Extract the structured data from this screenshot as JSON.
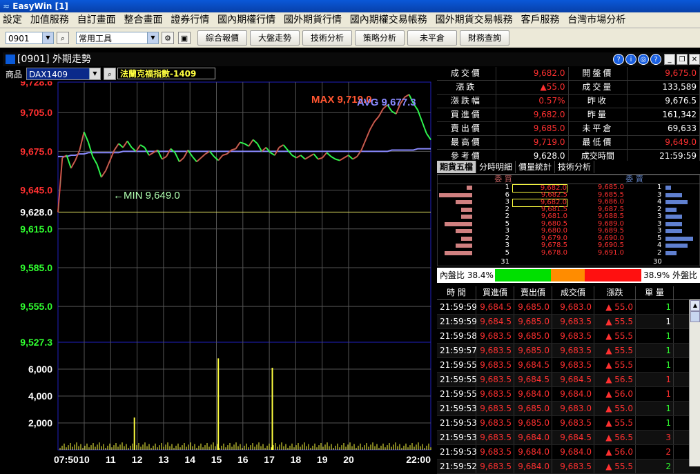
{
  "app": {
    "title": "EasyWin  [1]"
  },
  "menu": [
    "設定",
    "加值服務",
    "自訂畫面",
    "整合畫面",
    "證券行情",
    "國內期權行情",
    "國外期貨行情",
    "國內期權交易帳務",
    "國外期貨交易帳務",
    "客戶服務",
    "台灣市場分析"
  ],
  "toolbar": {
    "code_value": "0901",
    "tools_value": "常用工具",
    "buttons": [
      "綜合報價",
      "大盤走勢",
      "技術分析",
      "策略分析",
      "未平倉",
      "財務查詢"
    ]
  },
  "window": {
    "title": "[0901] 外期走勢",
    "controls": [
      "?",
      "i",
      "?"
    ]
  },
  "product": {
    "label": "商品",
    "code_value": "DAX1409",
    "name": "法蘭克福指數-1409"
  },
  "chart_data": {
    "type": "line",
    "x_ticks": [
      "07:50",
      "10",
      "11",
      "12",
      "13",
      "14",
      "15",
      "16",
      "17",
      "18",
      "19",
      "20",
      "22:00"
    ],
    "price_axis": {
      "ticks": [
        "9,728.6",
        "9,705.0",
        "9,675.0",
        "9,645.0",
        "9,628.0",
        "9,615.0",
        "9,585.0",
        "9,555.0",
        "9,527.3"
      ],
      "ylim": [
        9527.3,
        9728.6
      ],
      "reference": 9628.0
    },
    "volume_axis": {
      "ticks": [
        "6,000",
        "4,000",
        "2,000"
      ]
    },
    "annotations": {
      "max": "MAX 9,719.0",
      "avg": "AVG 9,677.3",
      "min": "←MIN 9,649.0"
    },
    "price_series": [
      9628.0,
      9670,
      9672,
      9662,
      9668,
      9676,
      9690,
      9682,
      9671,
      9665,
      9655,
      9660,
      9668,
      9676,
      9681,
      9678,
      9683,
      9678,
      9675,
      9680,
      9678,
      9672,
      9674,
      9676,
      9669,
      9671,
      9677,
      9674,
      9667,
      9670,
      9676,
      9671,
      9667,
      9670,
      9673,
      9675,
      9671,
      9668,
      9672,
      9673,
      9676,
      9677,
      9682,
      9681,
      9679,
      9684,
      9681,
      9675,
      9678,
      9674,
      9672,
      9678,
      9680,
      9676,
      9672,
      9670,
      9672,
      9669,
      9671,
      9673,
      9669,
      9670,
      9674,
      9671,
      9669,
      9668,
      9670,
      9672,
      9669,
      9671,
      9676,
      9684,
      9692,
      9698,
      9702,
      9708,
      9711,
      9706,
      9704,
      9712,
      9717,
      9719,
      9712,
      9707,
      9698,
      9689,
      9684
    ],
    "avg_series": [
      9671,
      9671,
      9671,
      9672,
      9672,
      9673,
      9673,
      9674,
      9674,
      9674,
      9674,
      9674,
      9674,
      9674,
      9674,
      9675,
      9675,
      9675,
      9675,
      9675,
      9675,
      9675,
      9675,
      9675,
      9675,
      9675,
      9675,
      9675,
      9675,
      9675,
      9675,
      9675,
      9675,
      9675,
      9675,
      9675,
      9675,
      9675,
      9675,
      9675,
      9675,
      9675,
      9675,
      9675,
      9675,
      9675,
      9675,
      9675,
      9675,
      9675,
      9675,
      9675,
      9675,
      9675,
      9675,
      9675,
      9675,
      9675,
      9675,
      9675,
      9675,
      9675,
      9675,
      9675,
      9675,
      9675,
      9675,
      9675,
      9675,
      9675,
      9675,
      9675,
      9675,
      9675,
      9675,
      9675,
      9675,
      9676,
      9676,
      9676,
      9676,
      9676,
      9676,
      9677,
      9677,
      9677,
      9677
    ],
    "volume_spikes": [
      {
        "x": 0.205,
        "v": 2400
      },
      {
        "x": 0.43,
        "v": 6800
      },
      {
        "x": 0.575,
        "v": 6100
      }
    ],
    "colors": {
      "price_up": "#ff3030",
      "price_down": "#30ff30",
      "price_line": "#2ad6a0",
      "avg": "#8a8aff",
      "ref": "#e0e060",
      "volume": "#ffff40",
      "grid": "#555555",
      "frame": "#2020c0"
    }
  },
  "quote": {
    "rows": [
      {
        "l1": "成交價",
        "v1": "9,682.0",
        "c1": "#ff3030",
        "l2": "開盤價",
        "v2": "9,675.0",
        "c2": "#ff3030"
      },
      {
        "l1": "漲跌",
        "v1": "▲55.0",
        "c1": "#ff3030",
        "l2": "成交量",
        "v2": "133,589",
        "c2": "#ffffff"
      },
      {
        "l1": "漲跌幅",
        "v1": "0.57%",
        "c1": "#ff3030",
        "l2": "昨收",
        "v2": "9,676.5",
        "c2": "#ffffff"
      },
      {
        "l1": "買進價",
        "v1": "9,682.0",
        "c1": "#ff3030",
        "l2": "昨量",
        "v2": "161,342",
        "c2": "#ffffff"
      },
      {
        "l1": "賣出價",
        "v1": "9,685.0",
        "c1": "#ff3030",
        "l2": "未平倉",
        "v2": "69,633",
        "c2": "#ffffff"
      },
      {
        "l1": "最高價",
        "v1": "9,719.0",
        "c1": "#ff3030",
        "l2": "最低價",
        "v2": "9,649.0",
        "c2": "#ff3030"
      },
      {
        "l1": "參考價",
        "v1": "9,628.0",
        "c1": "#ffffff",
        "l2": "成交時間",
        "v2": "21:59:59",
        "c2": "#ffffff"
      }
    ]
  },
  "tabs": [
    "期貨五檔",
    "分時明細",
    "價量統計",
    "技術分析"
  ],
  "orderbook": {
    "bid_header": "委 買",
    "ask_header": "委 賣",
    "rows": [
      {
        "bq": "1",
        "bp": "9,682.0",
        "ap": "9,685.0",
        "aq": "1"
      },
      {
        "bq": "6",
        "bp": "9,682.5",
        "ap": "9,685.5",
        "aq": "3"
      },
      {
        "bq": "3",
        "bp": "9,682.0",
        "ap": "9,686.0",
        "aq": "4"
      },
      {
        "bq": "2",
        "bp": "9,681.5",
        "ap": "9,687.5",
        "aq": "2"
      },
      {
        "bq": "2",
        "bp": "9,681.0",
        "ap": "9,688.5",
        "aq": "3"
      },
      {
        "bq": "5",
        "bp": "9,680.5",
        "ap": "9,689.0",
        "aq": "3"
      },
      {
        "bq": "3",
        "bp": "9,680.0",
        "ap": "9,689.5",
        "aq": "3"
      },
      {
        "bq": "2",
        "bp": "9,679.0",
        "ap": "9,690.0",
        "aq": "5"
      },
      {
        "bq": "3",
        "bp": "9,678.5",
        "ap": "9,690.5",
        "aq": "4"
      },
      {
        "bq": "5",
        "bp": "9,678.0",
        "ap": "9,691.0",
        "aq": "2"
      }
    ],
    "bid_total": "31",
    "ask_total": "30"
  },
  "ratio": {
    "left": "內盤比 38.4%",
    "right": "38.9% 外盤比",
    "bid_pct": 38.4,
    "mid_pct": 22.7,
    "ask_pct": 38.9
  },
  "ticks_table": {
    "headers": [
      "時 間",
      "買進價",
      "賣出價",
      "成交價",
      "漲跌",
      "單 量"
    ],
    "rows": [
      [
        "21:59:59",
        "9,684.5",
        "9,685.0",
        "9,683.0",
        "▲ 55.0",
        "1",
        "#30ff30"
      ],
      [
        "21:59:59",
        "9,684.5",
        "9,685.0",
        "9,683.5",
        "▲ 55.5",
        "1",
        "#ffffff"
      ],
      [
        "21:59:58",
        "9,683.5",
        "9,685.0",
        "9,683.5",
        "▲ 55.5",
        "1",
        "#30ff30"
      ],
      [
        "21:59:57",
        "9,683.5",
        "9,685.0",
        "9,683.5",
        "▲ 55.5",
        "1",
        "#30ff30"
      ],
      [
        "21:59:55",
        "9,683.5",
        "9,684.5",
        "9,683.5",
        "▲ 55.5",
        "1",
        "#30ff30"
      ],
      [
        "21:59:55",
        "9,683.5",
        "9,684.5",
        "9,684.5",
        "▲ 56.5",
        "1",
        "#ff3030"
      ],
      [
        "21:59:55",
        "9,683.5",
        "9,684.0",
        "9,684.0",
        "▲ 56.0",
        "1",
        "#ff3030"
      ],
      [
        "21:59:53",
        "9,683.5",
        "9,685.0",
        "9,683.0",
        "▲ 55.0",
        "1",
        "#30ff30"
      ],
      [
        "21:59:53",
        "9,683.5",
        "9,685.0",
        "9,683.5",
        "▲ 55.5",
        "1",
        "#30ff30"
      ],
      [
        "21:59:53",
        "9,683.5",
        "9,684.0",
        "9,684.5",
        "▲ 56.5",
        "3",
        "#ff3030"
      ],
      [
        "21:59:53",
        "9,683.5",
        "9,684.0",
        "9,684.0",
        "▲ 56.0",
        "2",
        "#ff3030"
      ],
      [
        "21:59:52",
        "9,683.5",
        "9,684.0",
        "9,683.5",
        "▲ 55.5",
        "2",
        "#30ff30"
      ]
    ]
  }
}
